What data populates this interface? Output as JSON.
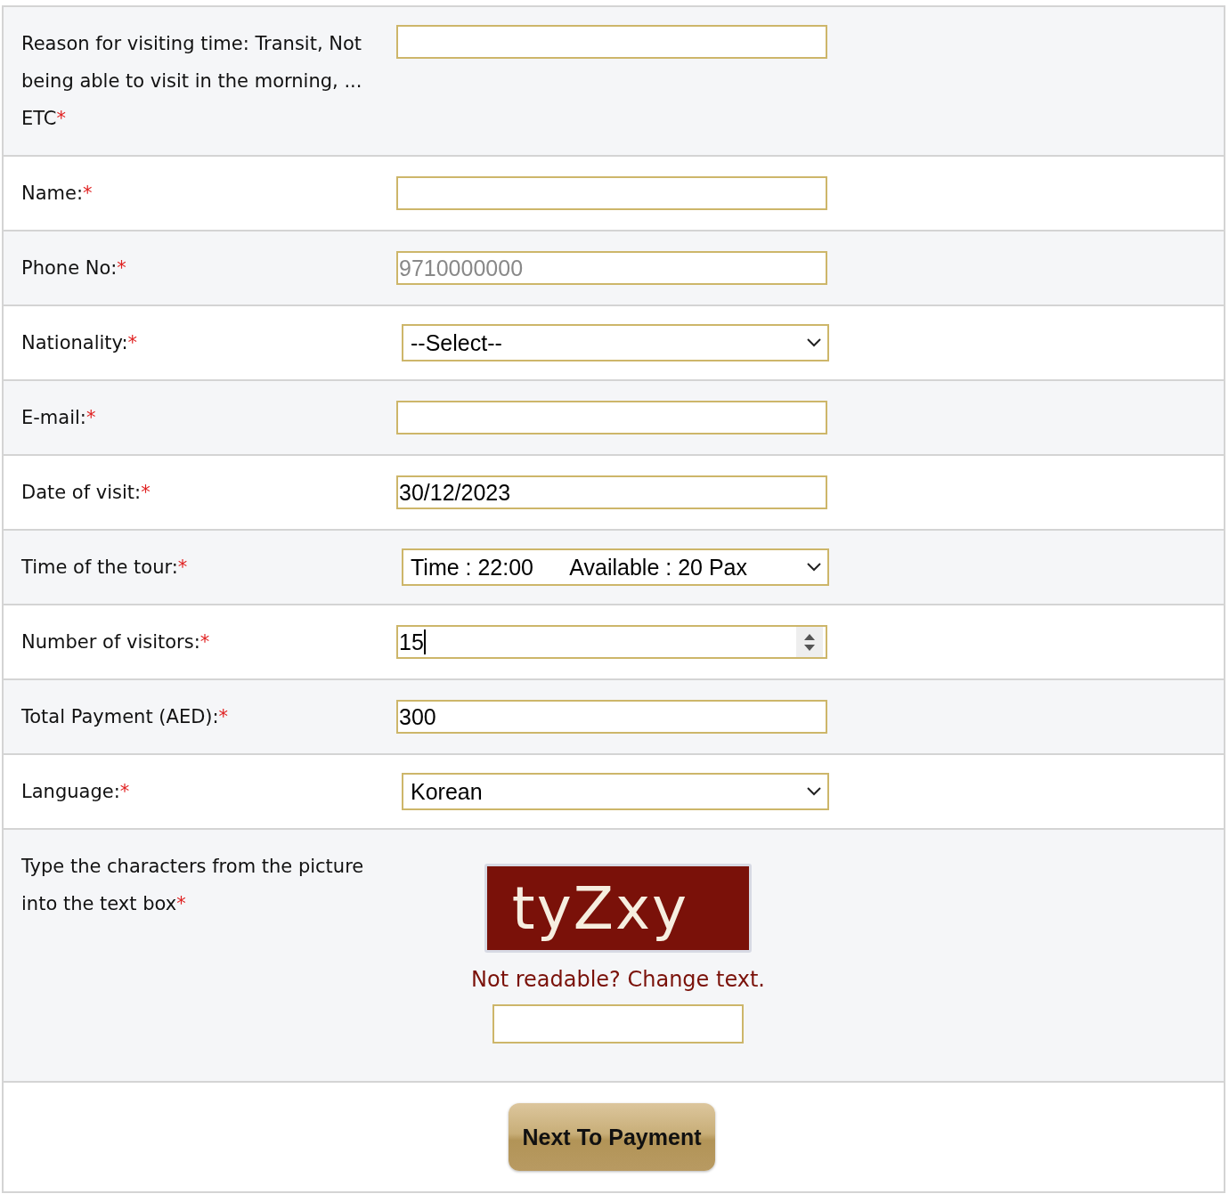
{
  "rows": [
    {
      "label": "Reason for visiting time: Transit, Not being able to visit in the morning, ... ETC",
      "required_mark": "*",
      "kind": "text",
      "value": ""
    },
    {
      "label": "Name:",
      "required_mark": "*",
      "kind": "text",
      "value": ""
    },
    {
      "label": "Phone No:",
      "required_mark": "*",
      "kind": "text",
      "placeholder": "9710000000"
    },
    {
      "label": "Nationality:",
      "required_mark": "*",
      "kind": "select",
      "value": "--Select--"
    },
    {
      "label": "E-mail:",
      "required_mark": "*",
      "kind": "text",
      "value": ""
    },
    {
      "label": "Date of visit:",
      "required_mark": "*",
      "kind": "text",
      "value": "30/12/2023"
    },
    {
      "label": "Time of the tour:",
      "required_mark": "*",
      "kind": "select",
      "value": "Time : 22:00      Available : 20 Pax"
    },
    {
      "label": "Number of visitors:",
      "required_mark": "*",
      "kind": "number",
      "value": "15"
    },
    {
      "label": "Total Payment (AED):",
      "required_mark": "*",
      "kind": "text",
      "value": "300"
    },
    {
      "label": "Language:",
      "required_mark": "*",
      "kind": "select",
      "value": "Korean"
    }
  ],
  "captcha": {
    "label": "Type the characters from the picture into the text box",
    "required_mark": "*",
    "characters": "tyZxy",
    "change_link": "Not readable? Change text."
  },
  "submit_button": "Next To Payment"
}
